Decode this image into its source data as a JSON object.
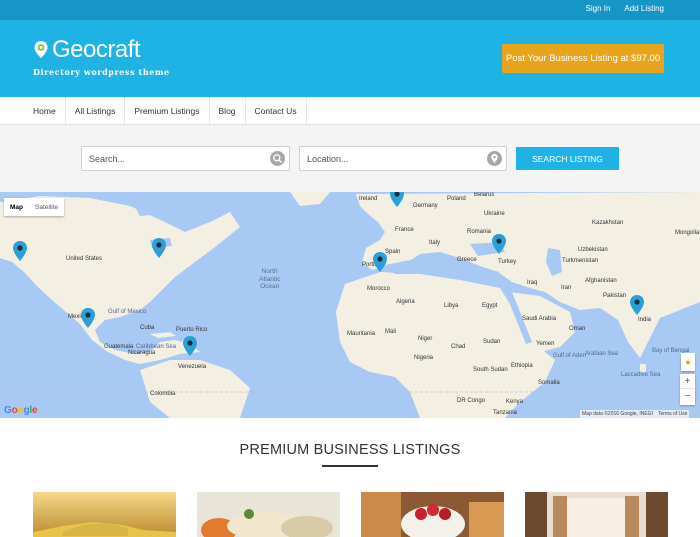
{
  "topbar": {
    "sign_in": "Sign In",
    "add_listing": "Add Listing"
  },
  "header": {
    "logo_text": "Geocraft",
    "tagline": "Directory wordpress theme",
    "cta_label": "Post Your Business Listing at $97.00"
  },
  "nav": {
    "items": [
      "Home",
      "All Listings",
      "Premium Listings",
      "Blog",
      "Contact Us"
    ]
  },
  "search": {
    "keyword_placeholder": "Search...",
    "location_placeholder": "Location...",
    "button_label": "SEARCH LISTING"
  },
  "map": {
    "type_map": "Map",
    "type_satellite": "Satellite",
    "google_logo": "Google",
    "attribution": "Map data ©2016 Google, INEGI",
    "terms": "Terms of Use",
    "ocean_label": "North\nAtlantic\nOcean",
    "labels": {
      "iceland": "Ireland",
      "belarus": "Belarus",
      "poland": "Poland",
      "germany": "Germany",
      "ukraine": "Ukraine",
      "kazakhstan": "Kazakhstan",
      "france": "France",
      "italy": "Italy",
      "romania": "Romania",
      "mongolia": "Mongolia",
      "uzbekistan": "Uzbekistan",
      "greece": "Greece",
      "turkey": "Turkey",
      "turkmenistan": "Turkmenistan",
      "spain": "Spain",
      "portugal": "Portu",
      "morocco": "Morocco",
      "iraq": "Iraq",
      "iran": "Iran",
      "afghanistan": "Afghanistan",
      "pakistan": "Pakistan",
      "algeria": "Algeria",
      "libya": "Libya",
      "egypt": "Egypt",
      "saudi": "Saudi Arabia",
      "india": "India",
      "oman": "Oman",
      "yemen": "Yemen",
      "mauritania": "Mauritania",
      "mali": "Mali",
      "niger": "Niger",
      "chad": "Chad",
      "sudan": "Sudan",
      "nigeria": "Nigeria",
      "south_sudan": "South Sudan",
      "ethiopia": "Ethiopia",
      "somalia": "Somalia",
      "drc": "DR Congo",
      "kenya": "Kenya",
      "tanzania": "Tanzania",
      "arabian_sea": "Arabian Sea",
      "bay_bengal": "Bay of Bengal",
      "laccadive": "Laccadive Sea",
      "united_states": "United States",
      "mexico": "Mexico",
      "cuba": "Cuba",
      "venezuela": "Venezuela",
      "colombia": "Colombia",
      "puerto_rico": "Puerto Rico",
      "guatemala": "Guatemala",
      "nicaragua": "Nicaragua",
      "caribbean": "Caribbean Sea",
      "gulf_mexico": "Gulf of Mexico",
      "gulf_aden": "Gulf of Aden"
    }
  },
  "premium": {
    "title": "PREMIUM BUSINESS LISTINGS"
  },
  "colors": {
    "topbar": "#1596c6",
    "header": "#1fb2e4",
    "cta": "#e6a51c",
    "map_water": "#a9c9f5",
    "map_land": "#f3efe3",
    "pin": "#2c9fd6"
  }
}
